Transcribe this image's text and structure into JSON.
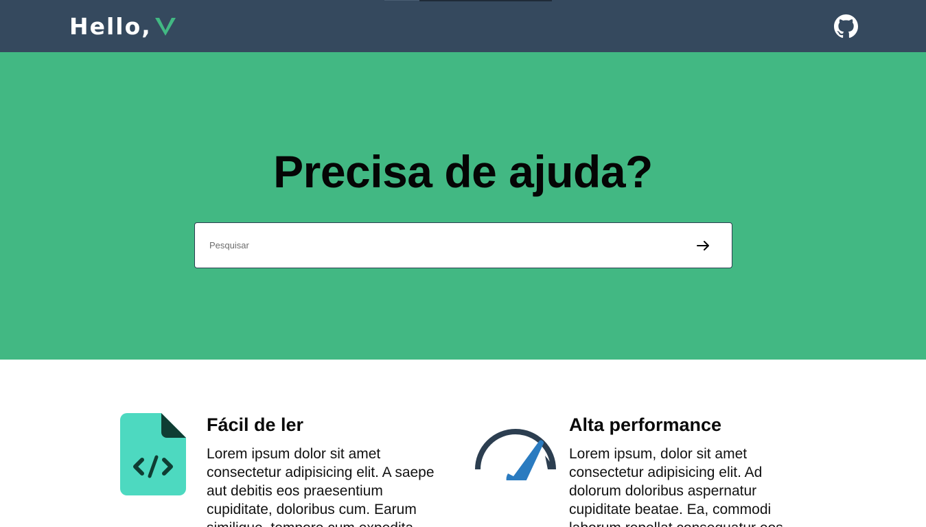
{
  "header": {
    "logo_text": "Hello,",
    "logo_mark": "V",
    "github_icon": "github-icon"
  },
  "hero": {
    "title": "Precisa de ajuda?",
    "search": {
      "placeholder": "Pesquisar",
      "value": "",
      "submit_icon": "arrow-right-icon"
    }
  },
  "features": [
    {
      "icon": "code-file-icon",
      "title": "Fácil de ler",
      "text": "Lorem ipsum dolor sit amet consectetur adipisicing elit. A saepe aut debitis eos praesentium cupiditate, doloribus cum. Earum similique, tempore cum expedita"
    },
    {
      "icon": "speedometer-icon",
      "title": "Alta performance",
      "text": "Lorem ipsum, dolor sit amet consectetur adipisicing elit. Ad dolorum doloribus aspernatur cupiditate beatae. Ea, commodi laborum repellat consequatur eos"
    }
  ],
  "colors": {
    "header_bg": "#35495e",
    "hero_bg": "#42b883",
    "accent": "#42b883",
    "code_icon": "#4dd9c0",
    "gauge_dark": "#2c3e50",
    "gauge_needle": "#2a7bc0"
  }
}
